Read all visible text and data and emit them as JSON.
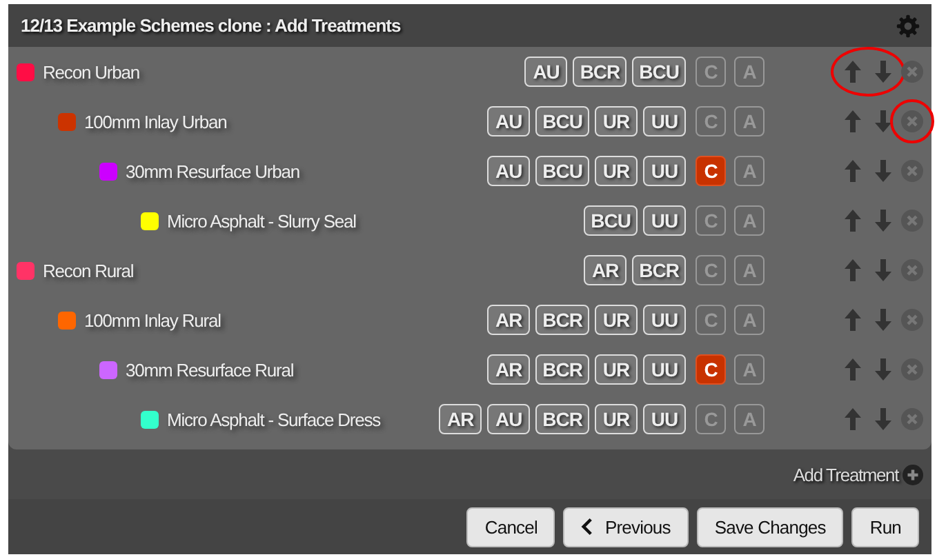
{
  "dialog": {
    "title": "12/13 Example Schemes clone : Add Treatments"
  },
  "treatments": [
    {
      "name": "Recon Urban",
      "color": "#ff0d45",
      "codes": [
        "AU",
        "BCR",
        "BCU"
      ],
      "flags": [
        {
          "label": "C",
          "on": false
        },
        {
          "label": "A",
          "on": false
        }
      ],
      "arrows_circled": true,
      "remove_circled": false,
      "children": [
        {
          "name": "100mm Inlay Urban",
          "color": "#cc3300",
          "codes": [
            "AU",
            "BCU",
            "UR",
            "UU"
          ],
          "flags": [
            {
              "label": "C",
              "on": false
            },
            {
              "label": "A",
              "on": false
            }
          ],
          "arrows_circled": false,
          "remove_circled": true,
          "children": [
            {
              "name": "30mm Resurface Urban",
              "color": "#cc00ff",
              "codes": [
                "AU",
                "BCU",
                "UR",
                "UU"
              ],
              "flags": [
                {
                  "label": "C",
                  "on": true
                },
                {
                  "label": "A",
                  "on": false
                }
              ],
              "arrows_circled": false,
              "remove_circled": false,
              "children": [
                {
                  "name": "Micro Asphalt - Slurry Seal",
                  "color": "#ffff00",
                  "codes": [
                    "BCU",
                    "UU"
                  ],
                  "flags": [
                    {
                      "label": "C",
                      "on": false
                    },
                    {
                      "label": "A",
                      "on": false
                    }
                  ],
                  "arrows_circled": false,
                  "remove_circled": false
                }
              ]
            }
          ]
        }
      ]
    },
    {
      "name": "Recon Rural",
      "color": "#ff3366",
      "codes": [
        "AR",
        "BCR"
      ],
      "flags": [
        {
          "label": "C",
          "on": false
        },
        {
          "label": "A",
          "on": false
        }
      ],
      "arrows_circled": false,
      "remove_circled": false,
      "children": [
        {
          "name": "100mm Inlay Rural",
          "color": "#ff6600",
          "codes": [
            "AR",
            "BCR",
            "UR",
            "UU"
          ],
          "flags": [
            {
              "label": "C",
              "on": false
            },
            {
              "label": "A",
              "on": false
            }
          ],
          "arrows_circled": false,
          "remove_circled": false,
          "children": [
            {
              "name": "30mm Resurface Rural",
              "color": "#cc66ff",
              "codes": [
                "AR",
                "BCR",
                "UR",
                "UU"
              ],
              "flags": [
                {
                  "label": "C",
                  "on": true
                },
                {
                  "label": "A",
                  "on": false
                }
              ],
              "arrows_circled": false,
              "remove_circled": false,
              "children": [
                {
                  "name": "Micro Asphalt - Surface Dress",
                  "color": "#33ffcc",
                  "codes": [
                    "AR",
                    "AU",
                    "BCR",
                    "UR",
                    "UU"
                  ],
                  "flags": [
                    {
                      "label": "C",
                      "on": false
                    },
                    {
                      "label": "A",
                      "on": false
                    }
                  ],
                  "arrows_circled": false,
                  "remove_circled": false
                }
              ]
            }
          ]
        }
      ]
    }
  ],
  "add_treatment": "Add Treatment",
  "buttons": [
    {
      "label": "Cancel",
      "kind": "plain"
    },
    {
      "label": "Previous",
      "kind": "back"
    },
    {
      "label": "Save Changes",
      "kind": "plain"
    },
    {
      "label": "Run",
      "kind": "plain"
    }
  ]
}
